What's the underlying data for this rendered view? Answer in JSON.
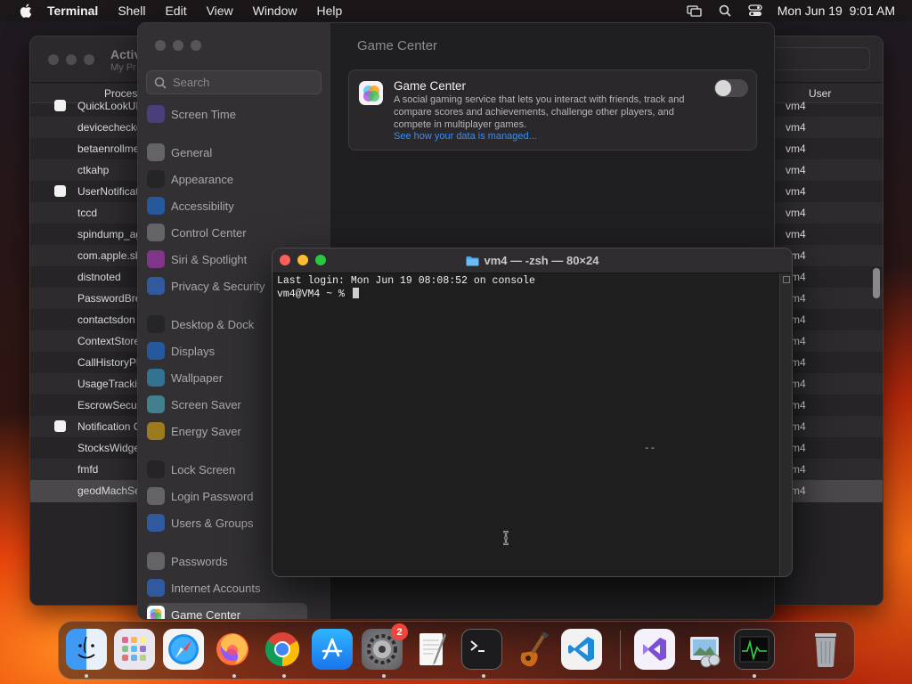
{
  "menubar": {
    "app_name": "Terminal",
    "items": [
      "Shell",
      "Edit",
      "View",
      "Window",
      "Help"
    ],
    "clock": "Mon Jun 19  9:01 AM"
  },
  "activity_monitor": {
    "title": "Activ",
    "subtitle": "My Pr",
    "col_process": "Proces",
    "col_user": "User",
    "rows": [
      {
        "name": "QuickLookUI",
        "user": "vm4",
        "icon": true
      },
      {
        "name": "devicecheckd",
        "user": "vm4",
        "icon": false
      },
      {
        "name": "betaenrollme",
        "user": "vm4",
        "icon": false
      },
      {
        "name": "ctkahp",
        "user": "vm4",
        "icon": false
      },
      {
        "name": "UserNotificat",
        "user": "vm4",
        "icon": true
      },
      {
        "name": "tccd",
        "user": "vm4",
        "icon": false
      },
      {
        "name": "spindump_ag",
        "user": "vm4",
        "icon": false
      },
      {
        "name": "com.apple.sb",
        "user": "vm4",
        "icon": false
      },
      {
        "name": "distnoted",
        "user": "vm4",
        "icon": false
      },
      {
        "name": "PasswordBre",
        "user": "vm4",
        "icon": false
      },
      {
        "name": "contactsdon",
        "user": "vm4",
        "icon": false
      },
      {
        "name": "ContextStore",
        "user": "vm4",
        "icon": false
      },
      {
        "name": "CallHistoryPl",
        "user": "vm4",
        "icon": false
      },
      {
        "name": "UsageTrackin",
        "user": "vm4",
        "icon": false
      },
      {
        "name": "EscrowSecur",
        "user": "vm4",
        "icon": false
      },
      {
        "name": "Notification C",
        "user": "vm4",
        "icon": true
      },
      {
        "name": "StocksWidge",
        "user": "vm4",
        "icon": false
      },
      {
        "name": "fmfd",
        "user": "vm4",
        "icon": false
      },
      {
        "name": "geodMachSe",
        "user": "vm4",
        "icon": false,
        "selected": true
      }
    ]
  },
  "settings": {
    "search_placeholder": "Search",
    "sidebar": [
      {
        "label": "Screen Time",
        "icon": "hourglass-icon",
        "color": "#5e4bb8"
      },
      {
        "label": "General",
        "icon": "gear-icon",
        "color": "#8e8e93"
      },
      {
        "label": "Appearance",
        "icon": "appearance-icon",
        "color": "#1c1c1e"
      },
      {
        "label": "Accessibility",
        "icon": "accessibility-icon",
        "color": "#1e7cf2"
      },
      {
        "label": "Control Center",
        "icon": "control-center-icon",
        "color": "#8e8e93"
      },
      {
        "label": "Siri & Spotlight",
        "icon": "siri-icon",
        "color": "#c23bd1"
      },
      {
        "label": "Privacy & Security",
        "icon": "hand-icon",
        "color": "#2f7cf6"
      },
      {
        "label": "Desktop & Dock",
        "icon": "dock-icon",
        "color": "#1c1c1e"
      },
      {
        "label": "Displays",
        "icon": "sun-icon",
        "color": "#1e7cf2"
      },
      {
        "label": "Wallpaper",
        "icon": "wallpaper-icon",
        "color": "#35aadc"
      },
      {
        "label": "Screen Saver",
        "icon": "screensaver-icon",
        "color": "#4ec2d6"
      },
      {
        "label": "Energy Saver",
        "icon": "battery-icon",
        "color": "#f2b90c"
      },
      {
        "label": "Lock Screen",
        "icon": "lock-icon",
        "color": "#1c1c1e"
      },
      {
        "label": "Login Password",
        "icon": "password-icon",
        "color": "#8e8e93"
      },
      {
        "label": "Users & Groups",
        "icon": "users-icon",
        "color": "#2f7cf6"
      },
      {
        "label": "Passwords",
        "icon": "key-icon",
        "color": "#8e8e93"
      },
      {
        "label": "Internet Accounts",
        "icon": "at-icon",
        "color": "#2f7cf6"
      },
      {
        "label": "Game Center",
        "icon": "game-center-icon",
        "color": "#ffffff",
        "active": true
      }
    ],
    "pane_title": "Game Center",
    "card": {
      "title": "Game Center",
      "description": "A social gaming service that lets you interact with friends, track and compare scores and achievements, challenge other players, and compete in multiplayer games.",
      "link": "See how your data is managed...",
      "toggle_on": false
    }
  },
  "terminal": {
    "title": "vm4 — -zsh — 80×24",
    "lines": [
      "Last login: Mon Jun 19 08:08:52 on console",
      "vm4@VM4 ~ % "
    ],
    "stray_text": "--"
  },
  "dock": {
    "apps": [
      "Finder",
      "Launchpad",
      "Safari",
      "Firefox",
      "Chrome",
      "App Store",
      "System Settings",
      "TextEdit",
      "Terminal",
      "GarageBand",
      "Visual Studio Code",
      "Visual Studio",
      "Preview",
      "Activity Monitor",
      "Trash"
    ],
    "settings_badge": "2"
  }
}
